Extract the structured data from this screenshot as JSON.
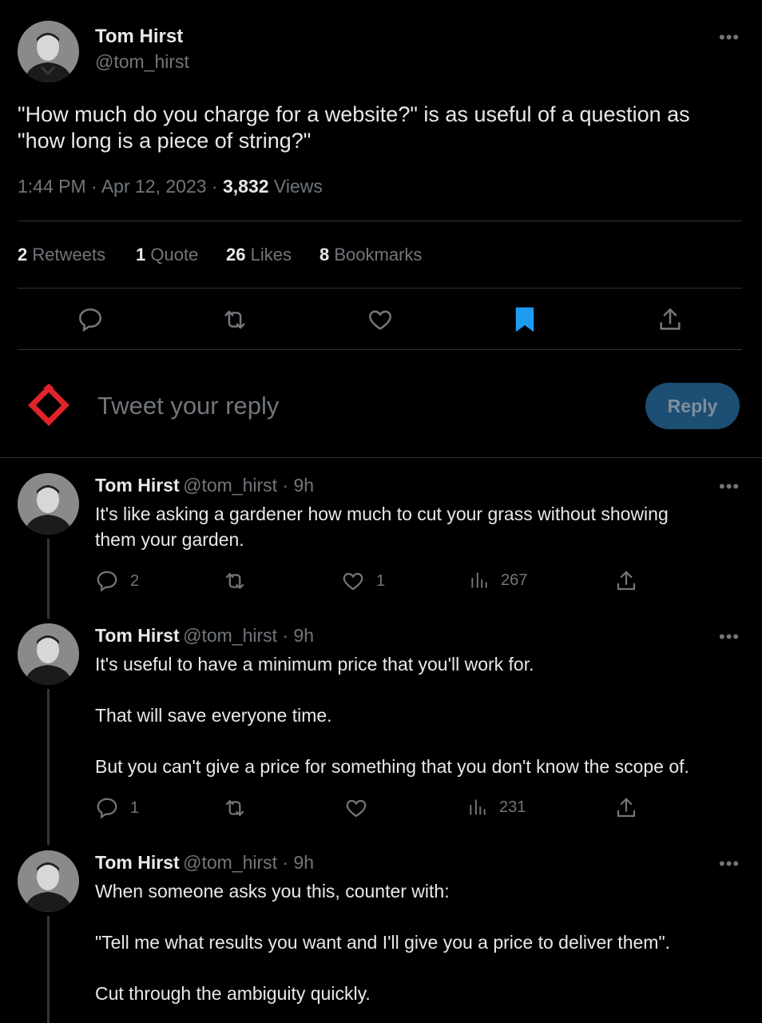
{
  "main_tweet": {
    "author_name": "Tom Hirst",
    "author_handle": "@tom_hirst",
    "more_label": "•••",
    "text_line1": "\"How much do you charge for a website?\" is as useful of a question as",
    "text_line2": "\"how long is a piece of string?\"",
    "time": "1:44 PM · Apr 12, 2023 · ",
    "views_count": "3,832",
    "views_label": " Views"
  },
  "stats": {
    "retweets_count": "2",
    "retweets_label": " Retweets",
    "quotes_count": "1",
    "quotes_label": " Quote",
    "likes_count": "26",
    "likes_label": " Likes",
    "bookmarks_count": "8",
    "bookmarks_label": " Bookmarks"
  },
  "composer": {
    "placeholder": "Tweet your reply",
    "reply_button": "Reply"
  },
  "replies": [
    {
      "name": "Tom Hirst",
      "handle": "@tom_hirst · 9h",
      "lines": [
        "It's like asking a gardener how much to cut your grass without showing",
        "them your garden."
      ],
      "replies": "2",
      "retweets": "",
      "likes": "1",
      "views": "267"
    },
    {
      "name": "Tom Hirst",
      "handle": "@tom_hirst · 9h",
      "lines": [
        "It's useful to have a minimum price that you'll work for.",
        "That will save everyone time.",
        "But you can't give a price for something that you don't know the scope of."
      ],
      "replies": "1",
      "retweets": "",
      "likes": "",
      "views": "231"
    },
    {
      "name": "Tom Hirst",
      "handle": "@tom_hirst · 9h",
      "lines": [
        "When someone asks you this, counter with:",
        "\"Tell me what results you want and I'll give you a price to deliver them\".",
        "Cut through the ambiguity quickly."
      ]
    }
  ],
  "colors": {
    "background": "#000000",
    "text": "#e7e9ea",
    "muted": "#71767b",
    "bookmark_active": "#1d9bf0",
    "reply_button_bg": "#1d4e73",
    "logo_red": "#e0242a"
  }
}
